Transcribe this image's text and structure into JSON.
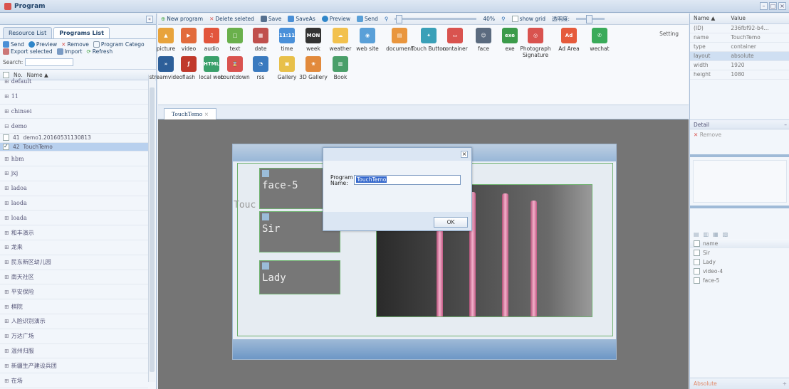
{
  "window": {
    "title": "Program"
  },
  "left": {
    "tabs": [
      "Resource List",
      "Programs List"
    ],
    "toolbar": [
      "Send",
      "Preview",
      "Remove",
      "Program Catego",
      "Export selected",
      "Import",
      "Refresh"
    ],
    "search_label": "Search:",
    "columns": {
      "no": "No.",
      "name": "Name ▲"
    },
    "groups": [
      "default",
      "11",
      "chinsei",
      "demo"
    ],
    "subrows": [
      {
        "no": "41",
        "name": "demo1.20160531130813",
        "selected": false
      },
      {
        "no": "42",
        "name": "TouchTemo",
        "selected": true
      }
    ],
    "groups2": [
      "hbm",
      "jxj",
      "ladoa",
      "laoda",
      "loada",
      "和丰演示",
      "龙来",
      "民东新区幼儿园",
      "南天社区",
      "平安保险",
      "棋院",
      "人脸识别演示",
      "万达广场",
      "温州归服",
      "新疆生产建设兵团",
      "在场"
    ]
  },
  "toolbar": {
    "new_program": "New program",
    "delete_selected": "Delete seleted",
    "save": "Save",
    "save_as": "SaveAs",
    "preview": "Preview",
    "send": "Send",
    "zoom": "40%",
    "show_grid": "show grid",
    "opacity": "透明度:"
  },
  "components": {
    "row1": [
      "picture",
      "video",
      "audio",
      "text",
      "date",
      "time",
      "week",
      "weather",
      "web site",
      "document",
      "Touch Button",
      "container",
      "face",
      "exe",
      "Photograph Signature",
      "Ad Area",
      "wechat"
    ],
    "row2": [
      "streamvideo",
      "flash",
      "local web",
      "countdown",
      "rss",
      "Gallery",
      "3D Gallery",
      "Book"
    ],
    "setting": "Setting"
  },
  "editor": {
    "tab": "TouchTemo",
    "widgets": [
      "face-5",
      "Sir",
      "Lady"
    ],
    "ghost_text": "Touc"
  },
  "dialog": {
    "label": "Program Name:",
    "value": "TouchTemo",
    "ok": "OK"
  },
  "properties": {
    "headers": [
      "Name ▲",
      "Value"
    ],
    "rows": [
      {
        "name": "(ID)",
        "value": "236fbf92-b4..."
      },
      {
        "name": "name",
        "value": "TouchTemo"
      },
      {
        "name": "type",
        "value": "container"
      },
      {
        "name": "layout",
        "value": "absolute"
      },
      {
        "name": "width",
        "value": "1920"
      },
      {
        "name": "height",
        "value": "1080"
      }
    ]
  },
  "detail": {
    "title": "Detail",
    "remove": "Remove",
    "list_header": "name",
    "items": [
      "Sir",
      "Lady",
      "video-4",
      "face-5"
    ],
    "bottom": "Absolute"
  }
}
